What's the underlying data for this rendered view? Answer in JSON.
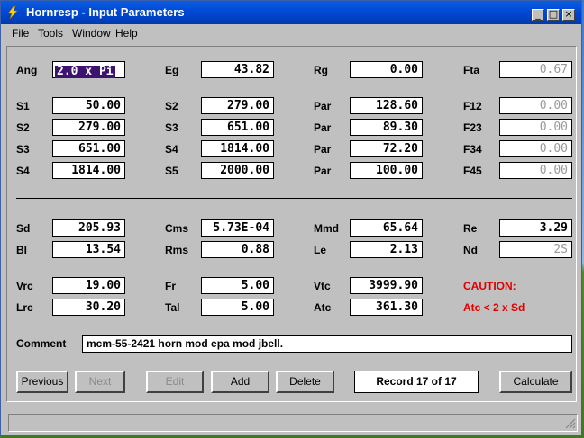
{
  "window": {
    "title": "Hornresp - Input Parameters",
    "controls": {
      "minimize": "_",
      "maximize": "□",
      "close": "×"
    }
  },
  "menu": {
    "items": [
      "File",
      "Tools",
      "Window",
      "Help"
    ]
  },
  "params": {
    "ang": {
      "label": "Ang",
      "value": "2.0 x Pi"
    },
    "eg": {
      "label": "Eg",
      "value": "43.82"
    },
    "rg": {
      "label": "Rg",
      "value": "0.00"
    },
    "fta": {
      "label": "Fta",
      "value": "0.67"
    },
    "rows_horn": [
      {
        "l1": "S1",
        "v1": "50.00",
        "l2": "S2",
        "v2": "279.00",
        "l3": "Par",
        "v3": "128.60",
        "l4": "F12",
        "v4": "0.00"
      },
      {
        "l1": "S2",
        "v1": "279.00",
        "l2": "S3",
        "v2": "651.00",
        "l3": "Par",
        "v3": "89.30",
        "l4": "F23",
        "v4": "0.00"
      },
      {
        "l1": "S3",
        "v1": "651.00",
        "l2": "S4",
        "v2": "1814.00",
        "l3": "Par",
        "v3": "72.20",
        "l4": "F34",
        "v4": "0.00"
      },
      {
        "l1": "S4",
        "v1": "1814.00",
        "l2": "S5",
        "v2": "2000.00",
        "l3": "Par",
        "v3": "100.00",
        "l4": "F45",
        "v4": "0.00"
      }
    ],
    "driver": [
      {
        "l1": "Sd",
        "v1": "205.93",
        "l2": "Cms",
        "v2": "5.73E-04",
        "l3": "Mmd",
        "v3": "65.64",
        "l4": "Re",
        "v4": "3.29"
      },
      {
        "l1": "Bl",
        "v1": "13.54",
        "l2": "Rms",
        "v2": "0.88",
        "l3": "Le",
        "v3": "2.13",
        "l4": "Nd",
        "v4": "2S"
      }
    ],
    "chamber": [
      {
        "l1": "Vrc",
        "v1": "19.00",
        "l2": "Fr",
        "v2": "5.00",
        "l3": "Vtc",
        "v3": "3999.90"
      },
      {
        "l1": "Lrc",
        "v1": "30.20",
        "l2": "Tal",
        "v2": "5.00",
        "l3": "Atc",
        "v3": "361.30"
      }
    ]
  },
  "caution": {
    "title": "CAUTION:",
    "message": "Atc < 2 x Sd",
    "color": "#e00000"
  },
  "comment": {
    "label": "Comment",
    "value": "mcm-55-2421 horn mod epa mod jbell."
  },
  "buttons": {
    "previous": "Previous",
    "next": "Next",
    "edit": "Edit",
    "add": "Add",
    "delete": "Delete",
    "calculate": "Calculate"
  },
  "record": "Record 17 of 17",
  "colors": {
    "titlebar": "#0049d6",
    "selection": "#3c1470",
    "face": "#c0c0c0"
  }
}
